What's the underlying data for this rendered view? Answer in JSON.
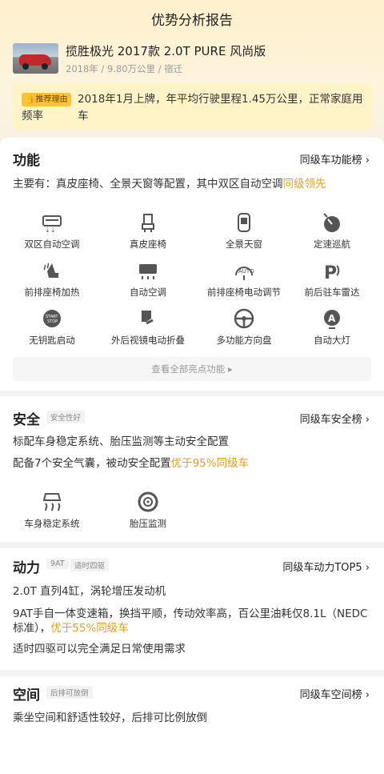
{
  "page": {
    "title": "优势分析报告"
  },
  "car": {
    "name": "揽胜极光 2017款 2.0T PURE 风尚版",
    "meta": "2018年 / 9.80万公里 / 宿迁"
  },
  "reason": {
    "badge": "推荐理由",
    "text_line1": "2018年1月上牌，年平均行驶里程1.45万公里，正常家庭用车",
    "text_line2": "频率"
  },
  "function": {
    "title": "功能",
    "link": "同级车功能榜",
    "summary_main": "主要有：真皮座椅、全景天窗等配置，其中双区自动空调",
    "summary_hl": "同级领先",
    "features": [
      {
        "label": "双区自动空调",
        "icon": "dual-zone-ac-icon"
      },
      {
        "label": "真皮座椅",
        "icon": "leather-seat-icon"
      },
      {
        "label": "全景天窗",
        "icon": "panoramic-sunroof-icon"
      },
      {
        "label": "定速巡航",
        "icon": "cruise-control-icon"
      },
      {
        "label": "前排座椅加热",
        "icon": "seat-heating-icon"
      },
      {
        "label": "自动空调",
        "icon": "auto-ac-icon"
      },
      {
        "label": "前排座椅电动调节",
        "icon": "power-seat-icon"
      },
      {
        "label": "前后驻车雷达",
        "icon": "parking-radar-icon"
      },
      {
        "label": "无钥匙启动",
        "icon": "keyless-start-icon"
      },
      {
        "label": "外后视镜电动折叠",
        "icon": "mirror-fold-icon"
      },
      {
        "label": "多功能方向盘",
        "icon": "steering-wheel-icon"
      },
      {
        "label": "自动大灯",
        "icon": "auto-headlight-icon"
      }
    ],
    "more": "查看全部亮点功能"
  },
  "safety": {
    "title": "安全",
    "tag": "安全性好",
    "link": "同级车安全榜",
    "line1": "标配车身稳定系统、胎压监测等主动安全配置",
    "line2_main": "配备7个安全气囊，被动安全配置",
    "line2_hl": "优于95%同级车",
    "features": [
      {
        "label": "车身稳定系统",
        "icon": "stability-control-icon"
      },
      {
        "label": "胎压监测",
        "icon": "tire-pressure-icon"
      }
    ]
  },
  "power": {
    "title": "动力",
    "tag1": "9AT",
    "tag2": "适时四驱",
    "link": "同级车动力TOP5",
    "line1": "2.0T 直列4缸，涡轮增压发动机",
    "line2": "9AT手自一体变速箱，换挡平顺，传动效率高，百公里油耗仅8.1L（NEDC",
    "line3_main": "标准），",
    "line3_hl": "优于55%同级车",
    "line4": "适时四驱可以完全满足日常使用需求"
  },
  "space": {
    "title": "空间",
    "tag": "后排可放倒",
    "link": "同级车空间榜",
    "line1": "乘坐空间和舒适性较好，后排可比例放倒"
  },
  "colors": {
    "accent": "#e0a020",
    "badge": "#f8c43b"
  }
}
